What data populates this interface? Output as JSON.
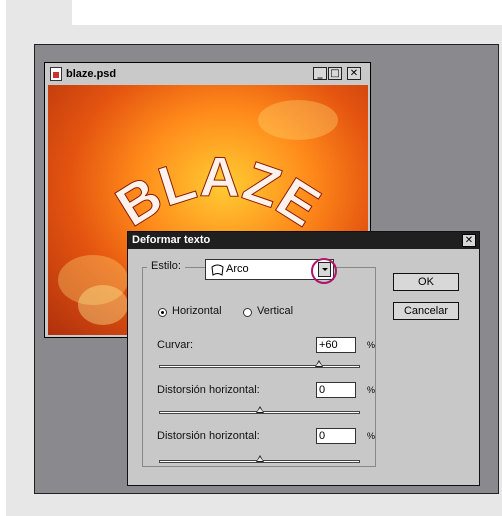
{
  "document_window": {
    "title": "blaze.psd",
    "controls": {
      "minimize": "_",
      "maximize": "□",
      "close": "✕"
    },
    "artwork_text": "BLAZE"
  },
  "dialog": {
    "title": "Deformar texto",
    "close": "✕",
    "style": {
      "label": "Estilo:",
      "value": "Arco",
      "icon": "arc-warp-icon"
    },
    "orientation": {
      "horizontal": "Horizontal",
      "vertical": "Vertical",
      "selected": "horizontal"
    },
    "ok": "OK",
    "cancel": "Cancelar",
    "sliders": [
      {
        "label": "Curvar:",
        "value": "+60",
        "unit": "%",
        "level": 0.8
      },
      {
        "label": "Distorsión horizontal:",
        "value": "0",
        "unit": "%",
        "level": 0.5
      },
      {
        "label": "Distorsión horizontal:",
        "value": "0",
        "unit": "%",
        "level": 0.5
      }
    ]
  },
  "colors": {
    "highlight_ring": "#b2146b",
    "dialog_title_bar": "#1f1f1f",
    "workspace": "#8a8a8e"
  }
}
